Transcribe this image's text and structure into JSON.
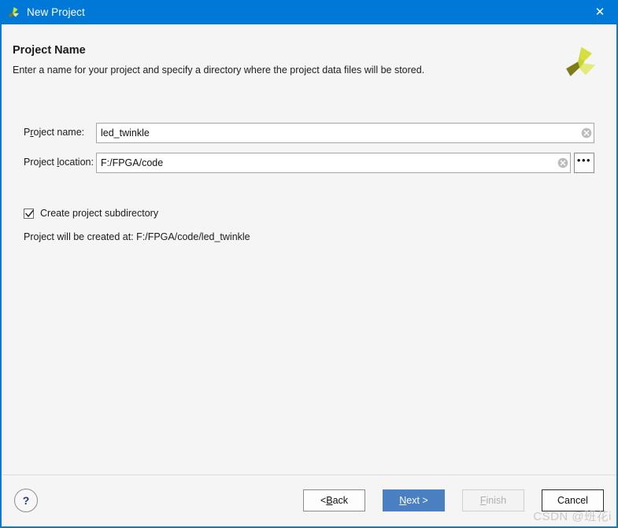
{
  "window": {
    "title": "New Project",
    "icon": "vivado-leaf-icon",
    "close_label": "✕"
  },
  "header": {
    "title": "Project Name",
    "subtitle": "Enter a name for your project and specify a directory where the project data files will be stored.",
    "logo": "vivado-leaf-logo"
  },
  "form": {
    "project_name": {
      "label_pre": "P",
      "label_mnemonic": "r",
      "label_post": "oject name:",
      "value": "led_twinkle",
      "placeholder": "",
      "clear_icon": "clear-circle-icon"
    },
    "project_location": {
      "label_pre": "Project ",
      "label_mnemonic": "l",
      "label_post": "ocation:",
      "value": "F:/FPGA/code",
      "placeholder": "",
      "clear_icon": "clear-circle-icon",
      "browse_label": "•••"
    },
    "create_subdirectory": {
      "label": "Create project subdirectory",
      "checked": true
    },
    "created_at_text": "Project will be created at: F:/FPGA/code/led_twinkle"
  },
  "footer": {
    "help_label": "?",
    "buttons": {
      "back": {
        "pre": "< ",
        "mnemonic": "B",
        "post": "ack"
      },
      "next": {
        "pre": "",
        "mnemonic": "N",
        "post": "ext >"
      },
      "finish": {
        "pre": "",
        "mnemonic": "F",
        "post": "inish",
        "disabled": true
      },
      "cancel": {
        "pre": "",
        "mnemonic": "",
        "post": "Cancel"
      }
    }
  },
  "watermark": "CSDN @班花i",
  "colors": {
    "titlebar": "#0078d7",
    "border": "#0e79c8",
    "primary_button": "#4a7fc1",
    "background": "#f5f5f5",
    "logo_bright": "#d6e03d",
    "logo_dark": "#7c7c18",
    "logo_light": "#e3eb7c"
  }
}
